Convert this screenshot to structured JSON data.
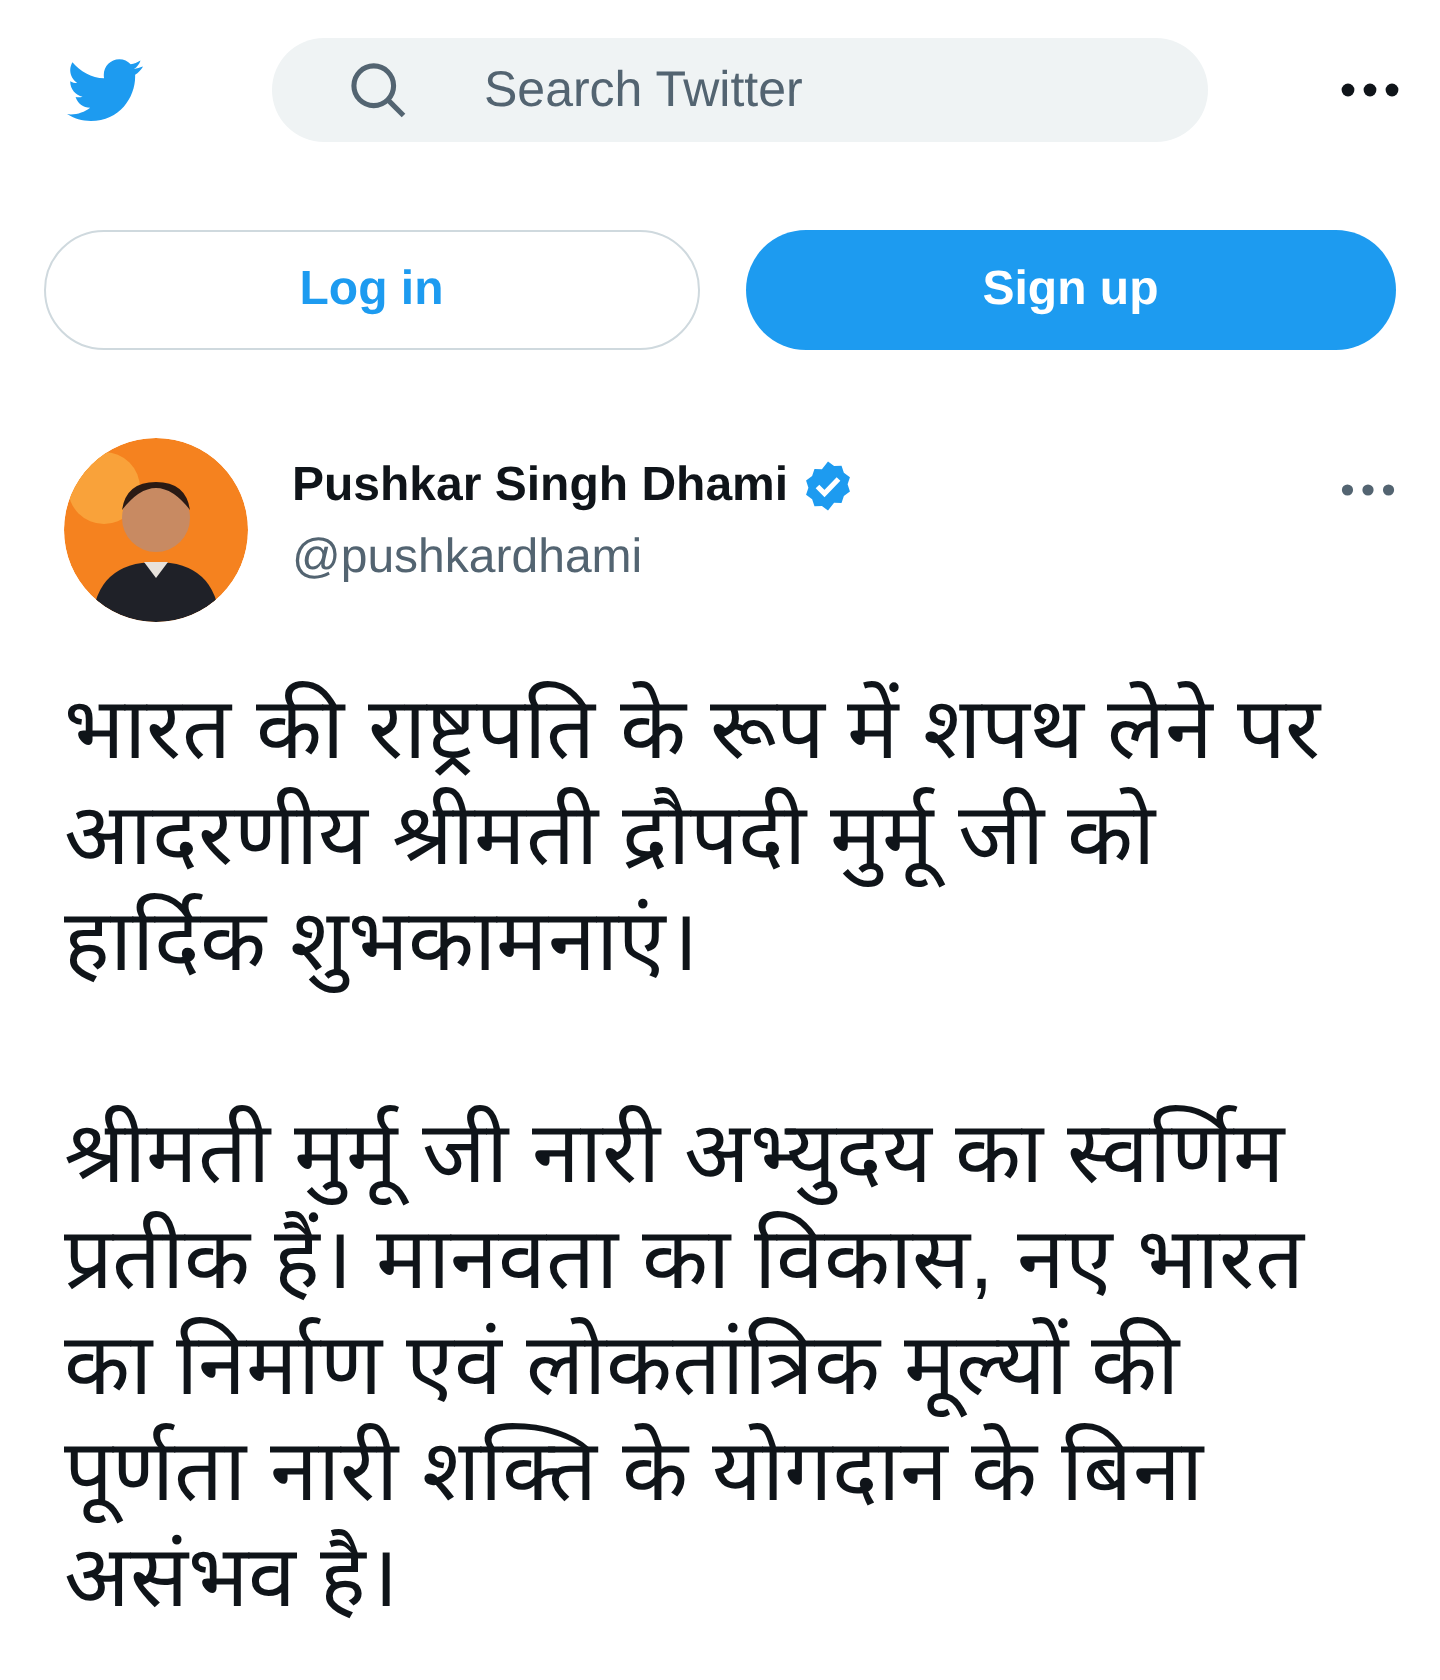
{
  "header": {
    "search": {
      "placeholder": "Search Twitter"
    }
  },
  "auth_buttons": [
    {
      "kind": "secondary",
      "label": "Log in"
    },
    {
      "kind": "primary",
      "label": "Sign up"
    }
  ],
  "tweet": {
    "author": {
      "name": "Pushkar Singh Dhami",
      "verified": true,
      "handle": "@pushkardhami"
    },
    "paragraphs": [
      "भारत की राष्ट्रपति के रूप में शपथ लेने पर आदरणीय श्रीमती द्रौपदी मुर्मू जी को हार्दिक शुभकामनाएं।",
      "श्रीमती मुर्मू जी नारी अभ्युदय का स्वर्णिम प्रतीक हैं। मानवता का विकास, नए भारत का निर्माण एवं लोकतांत्रिक मूल्यों की पूर्णता नारी शक्ति के योगदान के बिना असंभव है।"
    ]
  }
}
